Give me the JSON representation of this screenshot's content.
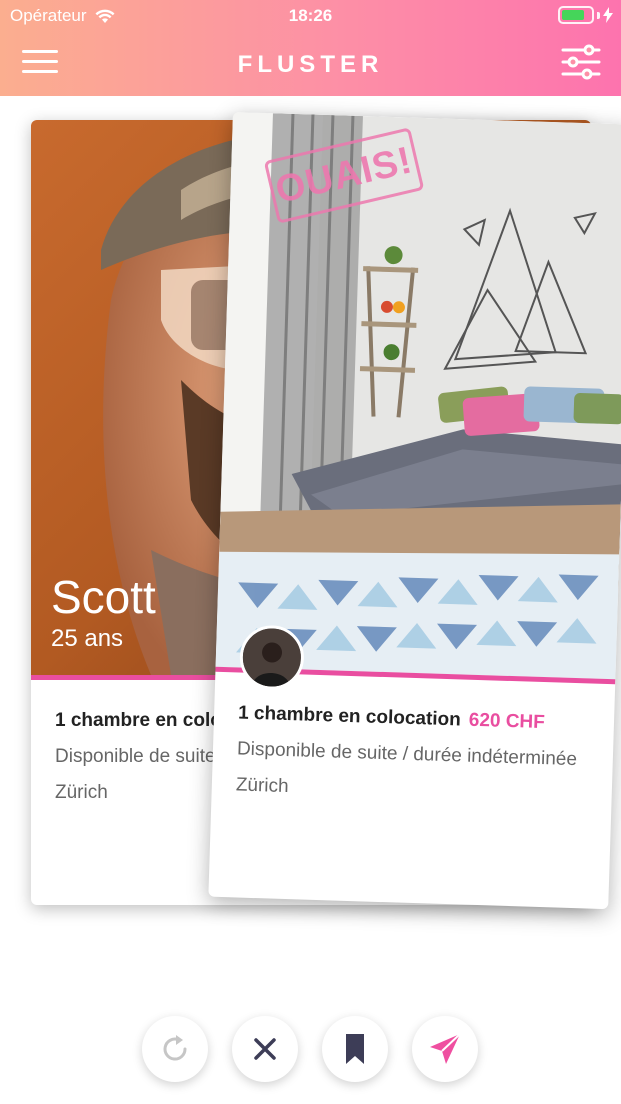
{
  "status_bar": {
    "carrier": "Opérateur",
    "time": "18:26",
    "battery_level": 0.8
  },
  "nav": {
    "title": "FLUSTER",
    "menu_icon": "hamburger-icon",
    "filter_icon": "sliders-icon"
  },
  "cards": {
    "back": {
      "person_name": "Scott",
      "person_age": "25 ans",
      "title": "1 chambre en colocation",
      "availability": "Disponible de suite / durée indéterminée",
      "city": "Zürich"
    },
    "front": {
      "stamp": "OUAIS!",
      "title": "1 chambre en colocation",
      "price": "620 CHF",
      "availability": "Disponible de suite / durée indéterminée",
      "city": "Zürich"
    }
  },
  "actions": [
    {
      "icon": "undo-icon"
    },
    {
      "icon": "close-icon"
    },
    {
      "icon": "bookmark-icon"
    },
    {
      "icon": "send-icon"
    }
  ],
  "colors": {
    "accent": "#e94ea0",
    "header_start": "#fbae8f",
    "header_end": "#fd73ae",
    "battery": "#45d55a"
  }
}
